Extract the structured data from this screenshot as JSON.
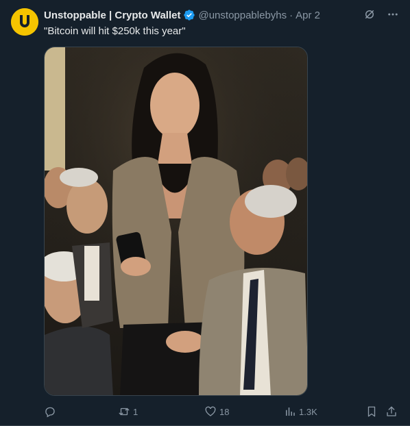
{
  "tweet": {
    "author": {
      "display_name": "Unstoppable | Crypto Wallet",
      "handle": "@unstoppablebyhs",
      "separator": "·",
      "date": "Apr 2",
      "avatar_letter": "U",
      "verified": true
    },
    "text": "\"Bitcoin will hit $250k this year\"",
    "media": {
      "type": "image",
      "description_icon": "painting-photo"
    },
    "actions": {
      "reply_count": "",
      "retweet_count": "1",
      "like_count": "18",
      "views_count": "1.3K"
    }
  },
  "colors": {
    "background": "#15202b",
    "text": "#e7e9ea",
    "muted": "#8b98a5",
    "verified": "#1d9bf0",
    "avatar": "#f5c400",
    "border": "#38444d"
  },
  "icons": {
    "header": [
      "grok-icon",
      "more-icon"
    ],
    "actions": [
      "reply-icon",
      "retweet-icon",
      "like-icon",
      "views-icon",
      "bookmark-icon",
      "share-icon"
    ]
  }
}
